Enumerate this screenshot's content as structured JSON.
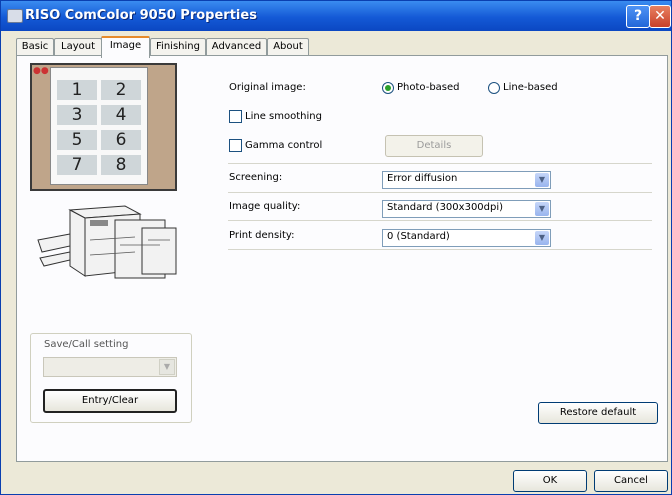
{
  "window": {
    "title": "RISO ComColor 9050 Properties",
    "help_label": "?",
    "close_label": "✕"
  },
  "tabs": [
    {
      "label": "Basic"
    },
    {
      "label": "Layout"
    },
    {
      "label": "Image",
      "active": true
    },
    {
      "label": "Finishing"
    },
    {
      "label": "Advanced"
    },
    {
      "label": "About"
    }
  ],
  "preview": {
    "pages": [
      "1",
      "2",
      "3",
      "4",
      "5",
      "6",
      "7",
      "8"
    ]
  },
  "original_image": {
    "label": "Original image:",
    "options": [
      {
        "label": "Photo-based",
        "selected": true
      },
      {
        "label": "Line-based",
        "selected": false
      }
    ]
  },
  "line_smoothing": {
    "label": "Line smoothing",
    "checked": false
  },
  "gamma_control": {
    "label": "Gamma control",
    "checked": false
  },
  "details_button": {
    "label": "Details"
  },
  "screening": {
    "label": "Screening:",
    "value": "Error diffusion"
  },
  "image_quality": {
    "label": "Image quality:",
    "value": "Standard (300x300dpi)"
  },
  "print_density": {
    "label": "Print density:",
    "value": "0 (Standard)"
  },
  "save_call": {
    "label": "Save/Call setting",
    "value": "",
    "entry_button": "Entry/Clear"
  },
  "restore_default": "Restore default",
  "footer": {
    "ok": "OK",
    "cancel": "Cancel"
  },
  "colors": {
    "titlebar": "#1459d6",
    "tab_highlight": "#e68b2c",
    "preview_bg": "#bfa58a"
  }
}
